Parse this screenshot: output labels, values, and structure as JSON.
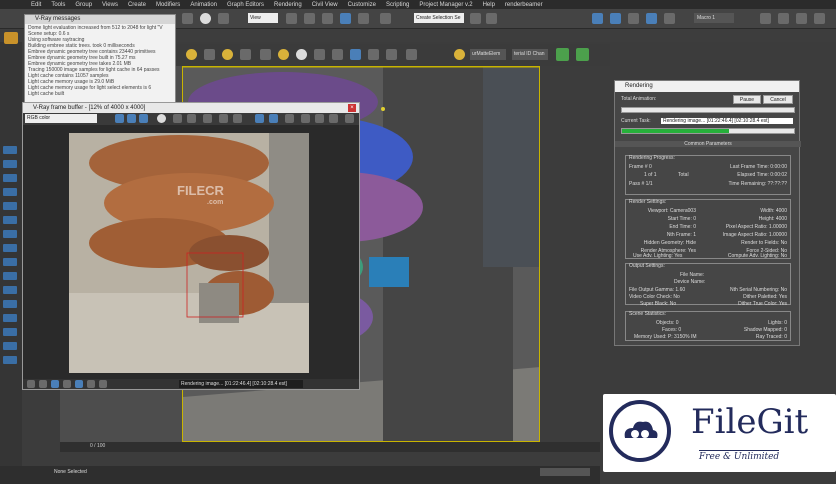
{
  "menu": [
    "Edit",
    "Tools",
    "Group",
    "Views",
    "Create",
    "Modifiers",
    "Animation",
    "Graph Editors",
    "Rendering",
    "Civil View",
    "Customize",
    "Scripting",
    "Project Manager v.2",
    "Help",
    "renderbeamer"
  ],
  "toolbar": {
    "view_dropdown": "View",
    "selection_set": "Create Selection Se",
    "macro_label": "Macro 1",
    "multimatte_label": "urMatteElem",
    "material_id_label": "terial ID Chan"
  },
  "vray_messages": {
    "title": "V-Ray messages",
    "lines": [
      "Dome light evaluation increased from 512 to 2048 for light \"V",
      "Scene setup: 0.6 s",
      "Using software raytracing",
      "Building embree static trees. took 0 milliseconds",
      "Embree dynamic geometry tree contains 23440 primitives",
      "Embree dynamic geometry tree built in 75.27 ms",
      "Embree dynamic geometry tree takes 2.01 MB",
      "Tracing 150000 image samples for light cache in 64 passes",
      "Light cache contains 11057 samples",
      "Light cache memory usage is 29.0 MiB",
      "Light cache memory usage for light select elements is 6",
      "Light cache built"
    ]
  },
  "vfb": {
    "title": "V-Ray frame buffer - [12% of 4000 x 4000]",
    "channel": "RGB color",
    "status": "Rendering image... [01:22:46.4] [02:10:28.4 est]"
  },
  "watermark_vfb": "FILECR",
  "watermark_vfb_sub": ".com",
  "rendering": {
    "title": "Rendering",
    "pause": "Pause",
    "cancel": "Cancel",
    "total_animation": "Total Animation:",
    "current_task_label": "Current Task:",
    "current_task": "Rendering image... [01:22:46.4] [02:10:28.4 est]",
    "progress": 0.62,
    "common_parameters": "Common Parameters",
    "progress_group": "Rendering Progress:",
    "frame": "Frame # 0",
    "of": "1 of 1",
    "total": "Total",
    "pass": "Pass # 1/1",
    "last_frame_time": "Last Frame Time: 0:00:00",
    "elapsed_time": "Elapsed Time: 0:00:02",
    "time_remaining": "Time Remaining: ??:??:??",
    "settings_group": "Render Settings:",
    "viewport": "Viewport: Camera003",
    "start_time": "Start Time: 0",
    "end_time": "End Time: 0",
    "nth_frame": "Nth Frame: 1",
    "hidden_geometry": "Hidden Geometry: Hide",
    "render_atmosphere": "Render Atmosphere: Yes",
    "use_adv_lighting": "Use Adv. Lighting: Yes",
    "width": "Width: 4000",
    "height": "Height: 4000",
    "pixel_aspect": "Pixel Aspect Ratio: 1.00000",
    "image_aspect": "Image Aspect Ratio: 1.00000",
    "render_to_fields": "Render to Fields: No",
    "force_2sided": "Force 2-Sided: No",
    "compute_adv_lighting": "Compute Adv. Lighting: No",
    "output_group": "Output Settings:",
    "file_name": "File Name:",
    "device_name": "Device Name:",
    "file_output_gamma": "File Output Gamma: 1.60",
    "video_color_check": "Video Color Check: No",
    "super_black": "Super Black: No",
    "nth_serial": "Nth Serial Numbering: No",
    "dither_paletted": "Dither Paletted: Yes",
    "dither_true_color": "Dither True Color: Yes",
    "stats_group": "Scene Statistics:",
    "objects": "Objects: 0",
    "faces": "Faces: 0",
    "memory_used": "Memory Used: P: 3150% IM",
    "lights": "Lights: 0",
    "shadow_mapped": "Shadow Mapped: 0",
    "ray_traced": "Ray Traced: 0"
  },
  "timeline": {
    "frame": "0 / 100"
  },
  "statusbar": {
    "selection": "None Selected"
  },
  "brand": {
    "name": "FileGit",
    "tagline": "Free & Unlimited"
  }
}
